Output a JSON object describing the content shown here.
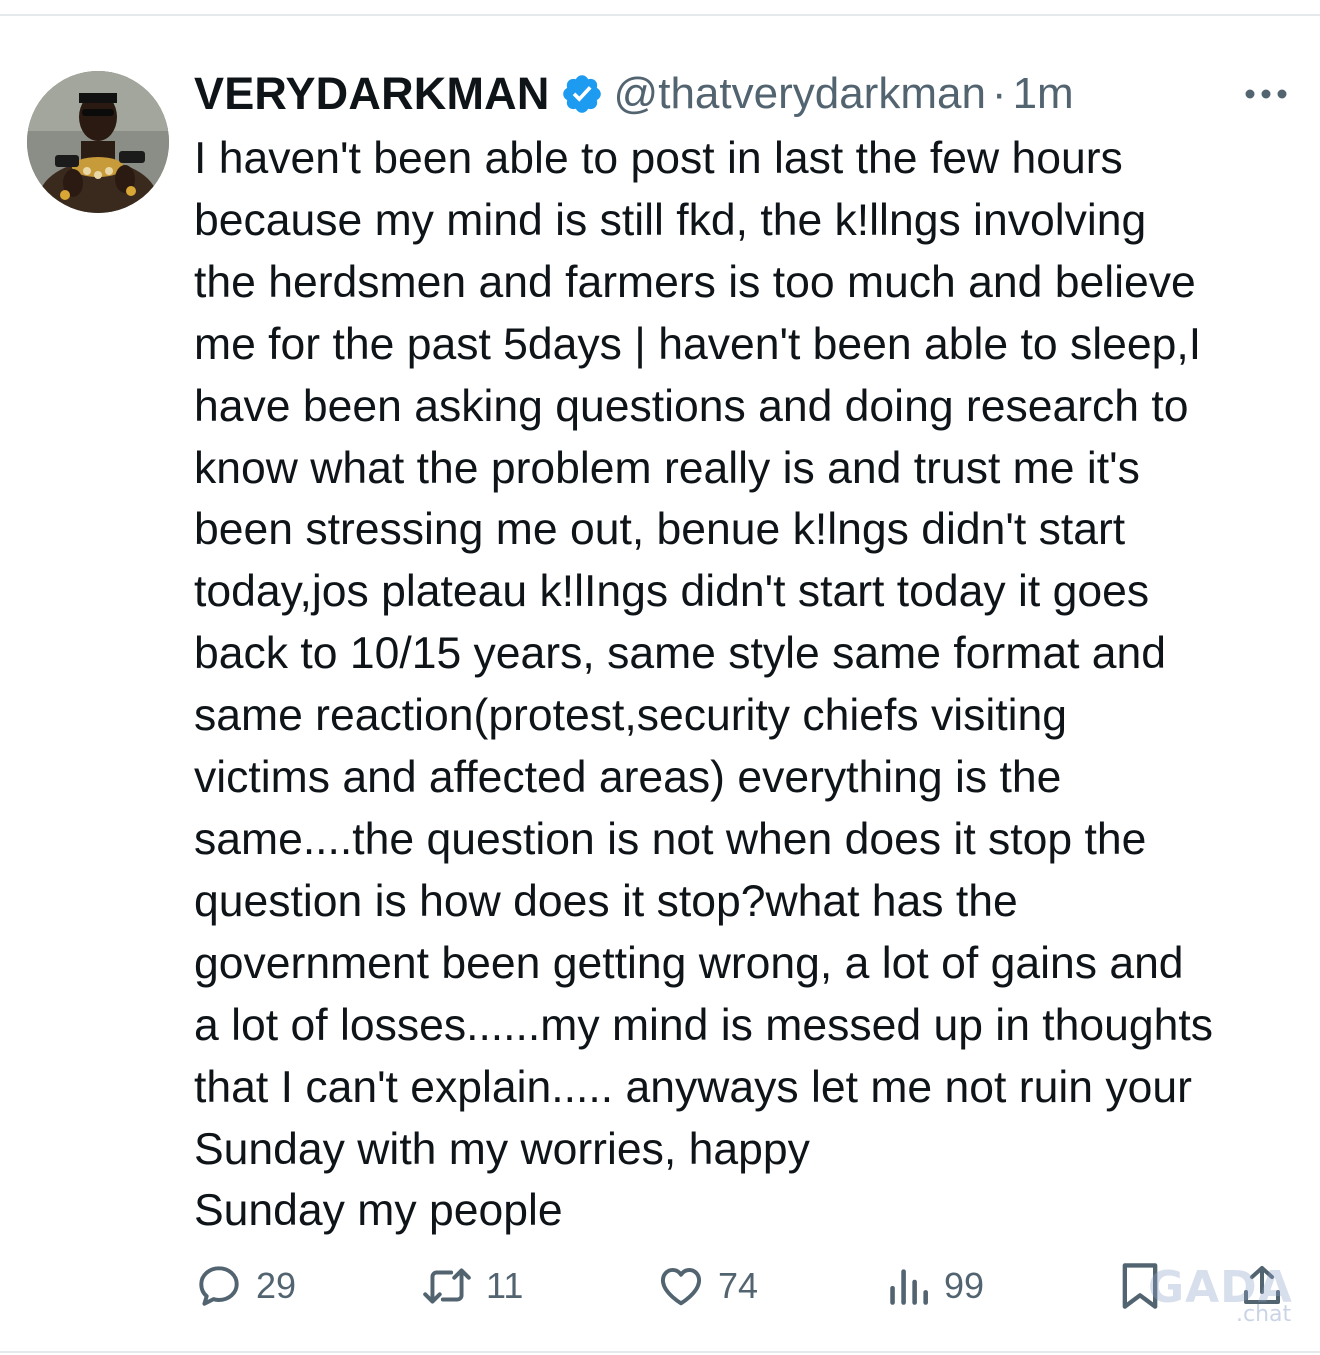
{
  "tweet": {
    "display_name": "VERYDARKMAN",
    "handle": "@thatverydarkman",
    "separator": "·",
    "time": "1m",
    "text": "I haven't been able to post in last the few hours\nbecause my mind is still fkd, the k!llngs involving\nthe herdsmen and farmers is too much and believe\nme for the past 5days | haven't been able to sleep,I\nhave been asking questions and doing research to\nknow what the problem really is and trust me it's\nbeen stressing me out, benue k!lngs didn't start\ntoday,jos plateau k!lIngs didn't start today it goes\nback to 10/15 years, same style same format and\nsame reaction(protest,security chiefs visiting\nvictims and affected areas) everything is the\nsame....the question is not when does it stop the\nquestion is how does it stop?what has the\ngovernment been getting wrong, a lot of gains and\na lot of losses......my mind is messed up in thoughts\nthat I can't explain..... anyways let me not ruin your\nSunday with my worries, happy\nSunday my people",
    "verified_color": "#1d9bf0"
  },
  "actions": {
    "replies": "29",
    "reposts": "11",
    "likes": "74",
    "views": "99"
  },
  "icons": {
    "verified": "verified-badge-icon",
    "more": "more-dots-icon",
    "reply": "reply-bubble-icon",
    "repost": "repost-arrows-icon",
    "like": "heart-icon",
    "views": "bar-chart-icon",
    "bookmark": "bookmark-icon",
    "share": "share-upload-icon"
  },
  "watermark": {
    "main": "GADA",
    "sub": ".chat"
  },
  "colors": {
    "text": "#0f1419",
    "secondary": "#536471",
    "divider": "#e6e9ec"
  }
}
